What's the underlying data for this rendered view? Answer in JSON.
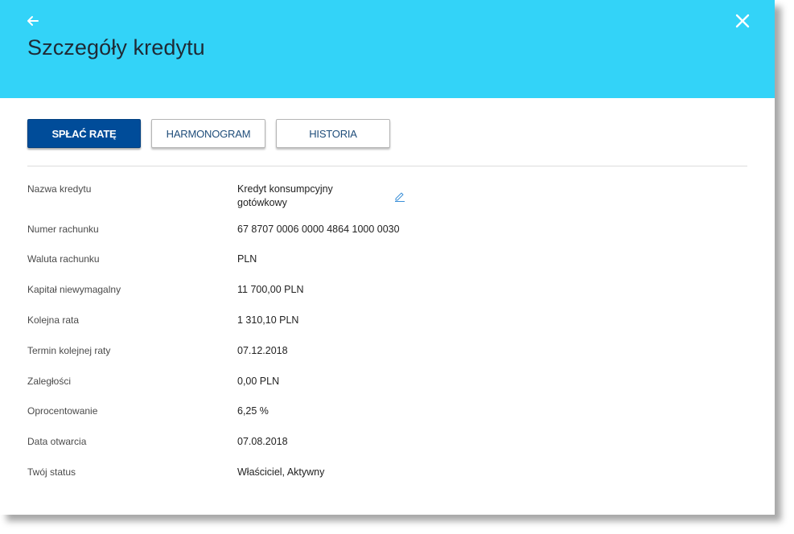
{
  "header": {
    "title": "Szczegóły kredytu",
    "color": "#33d3f8",
    "back_icon": "arrow-left-icon",
    "close_icon": "close-icon"
  },
  "actions": {
    "pay_installment": "SPŁAĆ RATĘ",
    "schedule": "HARMONOGRAM",
    "history": "HISTORIA",
    "primary_color": "#004c99"
  },
  "details": {
    "loan_name_label": "Nazwa kredytu",
    "loan_name_value": "Kredyt konsumpcyjny gotówkowy",
    "edit_icon": "pencil-icon",
    "account_number_label": "Numer rachunku",
    "account_number_value": "67 8707 0006 0000 4864 1000 0030",
    "currency_label": "Waluta rachunku",
    "currency_value": "PLN",
    "capital_label": "Kapitał niewymagalny",
    "capital_value": "11 700,00  PLN",
    "next_installment_label": "Kolejna rata",
    "next_installment_value": "1 310,10  PLN",
    "next_installment_date_label": "Termin kolejnej raty",
    "next_installment_date_value": "07.12.2018",
    "arrears_label": "Zaległości",
    "arrears_value": "0,00  PLN",
    "interest_label": "Oprocentowanie",
    "interest_value": "6,25 %",
    "opening_date_label": "Data otwarcia",
    "opening_date_value": "07.08.2018",
    "status_label": "Twój status",
    "status_value": "Właściciel, Aktywny"
  }
}
